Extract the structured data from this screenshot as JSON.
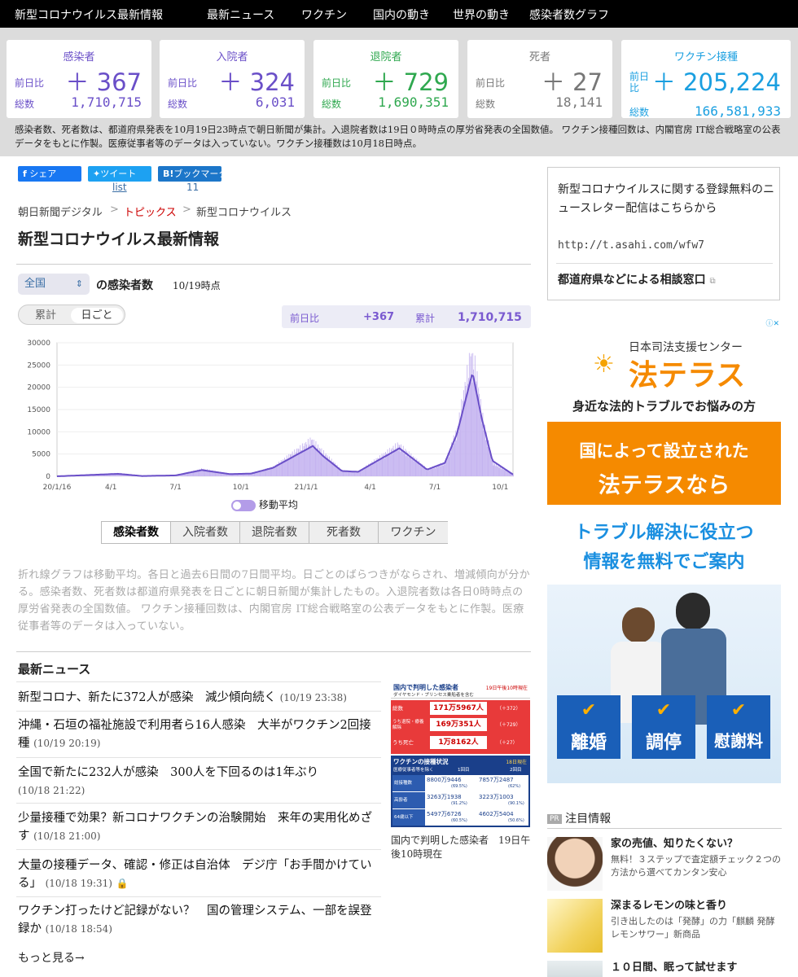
{
  "nav": {
    "items": [
      "新型コロナウイルス最新情報",
      "最新ニュース",
      "ワクチン",
      "国内の動き",
      "世界の動き",
      "感染者数グラフ"
    ]
  },
  "stats": {
    "cards": [
      {
        "title": "感染者",
        "diff_label": "前日比",
        "diff": "＋ 367",
        "total_label": "総数",
        "total": "1,710,715",
        "color": "#6a4fc8"
      },
      {
        "title": "入院者",
        "diff_label": "前日比",
        "diff": "＋ 324",
        "total_label": "総数",
        "total": "6,031",
        "color": "#6a4fc8"
      },
      {
        "title": "退院者",
        "diff_label": "前日比",
        "diff": "＋ 729",
        "total_label": "総数",
        "total": "1,690,351",
        "color": "#2fa84f"
      },
      {
        "title": "死者",
        "diff_label": "前日比",
        "diff": "＋ 27",
        "total_label": "総数",
        "total": "18,141",
        "color": "#777777"
      },
      {
        "title": "ワクチン接種",
        "diff_label": "前日比",
        "diff": "＋ 205,224",
        "total_label": "総数",
        "total": "166,581,933",
        "color": "#1a9fe0"
      }
    ],
    "note": "感染者数、死者数は、都道府県発表を10月19日23時点で朝日新聞が集計。入退院者数は19日０時時点の厚労省発表の全国数値。 ワクチン接種回数は、内閣官房 IT総合戦略室の公表データをもとに作製。医療従事者等のデータは入っていない。ワクチン接種数は10月18日時点。"
  },
  "share": {
    "facebook": "シェア",
    "twitter": "ツイート",
    "twitter_count": "list",
    "bookmark": "ブックマーク",
    "bookmark_count": "11"
  },
  "breadcrumb": {
    "home": "朝日新聞デジタル",
    "sep": ">",
    "topics": "トピックス",
    "current": "新型コロナウイルス"
  },
  "page_title": "新型コロナウイルス最新情報",
  "selector": {
    "region": "全国",
    "title": "の感染者数",
    "time": "10/19時点"
  },
  "toggle": {
    "cumulative": "累計",
    "daily": "日ごと"
  },
  "daybox": {
    "diff_label": "前日比",
    "diff": "+367",
    "total_label": "累計",
    "total": "1,710,715"
  },
  "chart_data": {
    "type": "bar",
    "series": [
      {
        "name": "移動平均",
        "type": "line"
      }
    ],
    "x_tick_labels": [
      "20/1/16",
      "4/1",
      "7/1",
      "10/1",
      "21/1/1",
      "4/1",
      "7/1",
      "10/1"
    ],
    "yticks": [
      0,
      5000,
      10000,
      15000,
      20000,
      25000,
      30000
    ],
    "ylim": [
      0,
      30000
    ],
    "daily_approx": {
      "x": [
        "2020-01-16",
        "2020-04-11",
        "2020-05-15",
        "2020-07-01",
        "2020-08-07",
        "2020-09-15",
        "2020-10-15",
        "2020-11-15",
        "2021-01-08",
        "2021-01-20",
        "2021-02-20",
        "2021-03-15",
        "2021-05-10",
        "2021-06-20",
        "2021-07-15",
        "2021-08-01",
        "2021-08-20",
        "2021-08-27",
        "2021-09-05",
        "2021-09-20",
        "2021-10-19"
      ],
      "y": [
        0,
        700,
        80,
        200,
        1600,
        500,
        600,
        2000,
        7800,
        5800,
        1200,
        1000,
        6800,
        1500,
        3000,
        10000,
        25800,
        23000,
        13000,
        3000,
        370
      ]
    },
    "moving_average_approx": {
      "x": [
        "2020-01-16",
        "2020-04-11",
        "2020-05-15",
        "2020-07-01",
        "2020-08-07",
        "2020-09-15",
        "2020-10-15",
        "2020-11-15",
        "2021-01-10",
        "2021-01-25",
        "2021-02-20",
        "2021-03-15",
        "2021-05-12",
        "2021-06-20",
        "2021-07-15",
        "2021-08-01",
        "2021-08-23",
        "2021-09-05",
        "2021-09-20",
        "2021-10-19"
      ],
      "y": [
        0,
        550,
        60,
        200,
        1400,
        500,
        600,
        1900,
        6800,
        4500,
        1200,
        1000,
        6300,
        1500,
        3000,
        9500,
        23300,
        13000,
        3500,
        400
      ]
    }
  },
  "legend": {
    "label": "移動平均"
  },
  "tabs": [
    "感染者数",
    "入院者数",
    "退院者数",
    "死者数",
    "ワクチン"
  ],
  "description": "折れ線グラフは移動平均。各日と過去6日間の7日間平均。日ごとのばらつきがならされ、増減傾向が分かる。感染者数、死者数は都道府県発表を日ごとに朝日新聞が集計したもの。入退院者数は各日0時時点の厚労省発表の全国数値。 ワクチン接種回数は、内閣官房 IT総合戦略室の公表データをもとに作製。医療従事者等のデータは入っていない。",
  "news": {
    "heading": "最新ニュース",
    "items": [
      {
        "title": "新型コロナ、新たに372人が感染　減少傾向続く",
        "time": "(10/19 23:38)"
      },
      {
        "title": "沖縄・石垣の福祉施設で利用者ら16人感染　大半がワクチン2回接種",
        "time": "(10/19 20:19)"
      },
      {
        "title": "全国で新たに232人が感染　300人を下回るのは1年ぶり",
        "time": "(10/18 21:22)"
      },
      {
        "title": "少量接種で効果？新コロナワクチンの治験開始　来年の実用化めざす",
        "time": "(10/18 21:00)"
      },
      {
        "title": "大量の接種データ、確認・修正は自治体　デジ庁「お手間かけている」",
        "time": "(10/18 19:31)"
      },
      {
        "title": "ワクチン打ったけど記録がない？　国の管理システム、一部を誤登録か",
        "time": "(10/18 18:54)"
      }
    ],
    "more": "もっと見る→"
  },
  "covid_image": {
    "header": "国内で判明した感染者",
    "header_time": "19日午後10時現在",
    "sub": "ダイヤモンド・プリンセス乗船者を含む",
    "rows": [
      {
        "label": "総数",
        "value": "171万5967人",
        "diff": "（＋372）"
      },
      {
        "label": "うち退院・療養解除",
        "value": "169万351人",
        "diff": "（＋729）"
      },
      {
        "label": "うち死亡",
        "value": "1万8162人",
        "diff": "（＋27）"
      }
    ],
    "vac_header": "ワクチンの接種状況",
    "vac_time": "18日現在",
    "vac_sub": "医療従事者等を除く",
    "vac_col1": "1回目",
    "vac_col2": "2回目",
    "vac_rows": [
      {
        "label": "総接種数",
        "v1": "8800万9446",
        "p1": "(69.5%)",
        "v2": "7857万2487",
        "p2": "(62%)"
      },
      {
        "label": "高齢者",
        "v1": "3263万1938",
        "p1": "(91.2%)",
        "v2": "3223万1003",
        "p2": "(90.1%)"
      },
      {
        "label": "64歳以下",
        "v1": "5497万6726",
        "p1": "(60.5%)",
        "v2": "4602万5404",
        "p2": "(50.6%)"
      }
    ],
    "caption": "国内で判明した感染者　19日午後10時現在"
  },
  "newsletter": {
    "text": "新型コロナウイルスに関する登録無料のニュースレター配信はこちらから",
    "url": "http://t.asahi.com/wfw7",
    "link": "都道府県などによる相談窓口"
  },
  "ad": {
    "org": "日本司法支援センター",
    "brand": "法テラス",
    "tagline": "身近な法的トラブルでお悩みの方",
    "mid1": "国によって設立された",
    "mid2": "法テラスなら",
    "blue1": "トラブル解決に役立つ",
    "blue2": "情報を無料でご案内",
    "boxes": [
      "離婚",
      "調停",
      "慰謝料"
    ]
  },
  "pr": {
    "badge": "PR",
    "heading": "注目情報",
    "items": [
      {
        "title": "家の売値、知りたくない？",
        "sub": "無料！３ステップで査定額チェック２つの方法から選べてカンタン安心"
      },
      {
        "title": "深まるレモンの味と香り",
        "sub": "引き出したのは「発酵」の力「麒麟 発酵レモンサワー」新商品"
      },
      {
        "title": "１０日間、眠って試せます",
        "sub": ""
      }
    ]
  }
}
